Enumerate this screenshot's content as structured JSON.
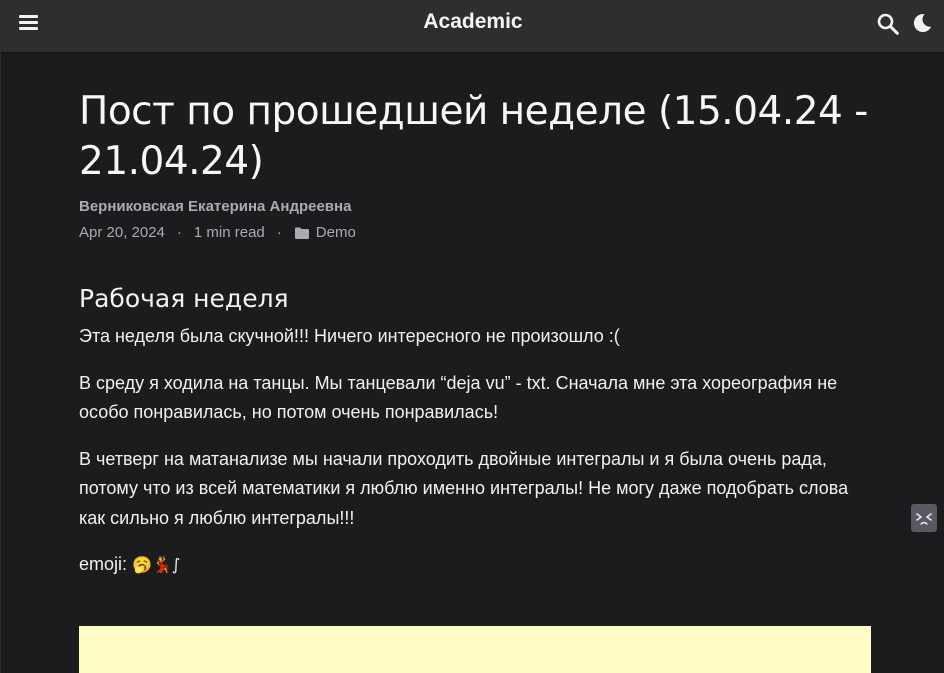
{
  "navbar": {
    "brand": "Academic",
    "menu_icon": "hamburger-menu-icon",
    "search_icon": "search-icon",
    "theme_icon": "moon-icon"
  },
  "post": {
    "title": "Пост по прошедшей неделе (15.04.24 - 21.04.24)",
    "author": "Верниковская Екатерина Андреевна",
    "date": "Apr 20, 2024",
    "separator": "·",
    "read_time": "1 min read",
    "category": "Demo",
    "heading": "Рабочая неделя",
    "paragraphs": [
      "Эта неделя была скучной!!! Ничего интересного не произошло :(",
      "В среду я ходила на танцы. Мы танцевали “deja vu” - txt. Сначала мне эта хореография не особо понравилась, но потом очень понравилась!",
      "В четверг на матанализе мы начали проходить двойные интегралы и я была очень рада, потому что из всей математики я люблю именно интегралы! Не могу даже подобрать слова как сильно я люблю интегралы!!!"
    ],
    "emoji_label": "emoji: ",
    "emoji_text": "🥱💃∫"
  },
  "colors": {
    "page_background": "#1b1c1e",
    "navbar_background": "#2d2e30",
    "muted_text": "#a9abb0",
    "highlight_box": "#fffcc6"
  }
}
